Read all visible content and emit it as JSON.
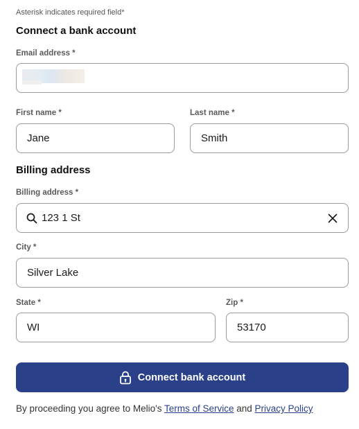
{
  "form": {
    "required_hint": "Asterisk indicates required field*",
    "section_bank": "Connect a bank account",
    "section_billing": "Billing address",
    "email": {
      "label": "Email address *",
      "value": ""
    },
    "first_name": {
      "label": "First name *",
      "value": "Jane"
    },
    "last_name": {
      "label": "Last name *",
      "value": "Smith"
    },
    "billing_address": {
      "label": "Billing address *",
      "value": "123 1 St"
    },
    "city": {
      "label": "City *",
      "value": "Silver Lake"
    },
    "state": {
      "label": "State *",
      "value": "WI"
    },
    "zip": {
      "label": "Zip *",
      "value": "53170"
    },
    "submit_label": "Connect bank account"
  },
  "consent": {
    "prefix": "By proceeding you agree to Melio's ",
    "terms_link": "Terms of Service",
    "middle": " and ",
    "privacy_link": "Privacy Policy"
  },
  "icons": {
    "search": "search-icon",
    "clear": "close-icon",
    "lock": "lock-icon"
  },
  "colors": {
    "primary": "#2a4189",
    "border": "#9a9a9a",
    "label": "#5a5a5a"
  }
}
